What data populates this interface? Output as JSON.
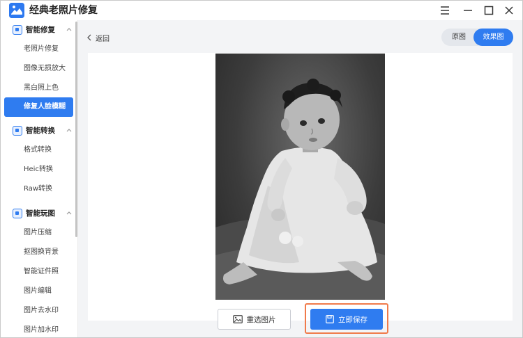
{
  "app": {
    "title": "经典老照片修复",
    "logo_icon": "photo-repair-app-logo"
  },
  "window_controls": [
    "menu-icon",
    "minimize-icon",
    "maximize-icon",
    "close-icon"
  ],
  "sidebar": {
    "groups": [
      {
        "label": "智能修复",
        "icon": "image-repair-icon",
        "expanded": true,
        "items": [
          {
            "label": "老照片修复",
            "active": false
          },
          {
            "label": "图像无损放大",
            "active": false
          },
          {
            "label": "黑白照上色",
            "active": false
          },
          {
            "label": "修复人脸模糊",
            "active": true
          }
        ]
      },
      {
        "label": "智能转换",
        "icon": "format-convert-icon",
        "expanded": true,
        "items": [
          {
            "label": "格式转换",
            "active": false
          },
          {
            "label": "Heic转换",
            "active": false
          },
          {
            "label": "Raw转换",
            "active": false
          }
        ]
      },
      {
        "label": "智能玩图",
        "icon": "image-tools-icon",
        "expanded": true,
        "items": [
          {
            "label": "图片压缩",
            "active": false
          },
          {
            "label": "抠图换背景",
            "active": false
          },
          {
            "label": "智能证件照",
            "active": false
          },
          {
            "label": "图片编辑",
            "active": false
          },
          {
            "label": "图片去水印",
            "active": false
          },
          {
            "label": "图片加水印",
            "active": false
          }
        ]
      }
    ]
  },
  "main": {
    "back_label": "返回",
    "view_toggle": {
      "original_label": "原图",
      "effect_label": "效果图",
      "selected": "效果图"
    },
    "photo_icon": "baby-photo-black-white",
    "reselect_label": "重选图片",
    "save_label": "立即保存"
  },
  "colors": {
    "accent": "#2f7cf0",
    "highlight_border": "#f07a4a",
    "main_bg": "#f3f4f6"
  }
}
